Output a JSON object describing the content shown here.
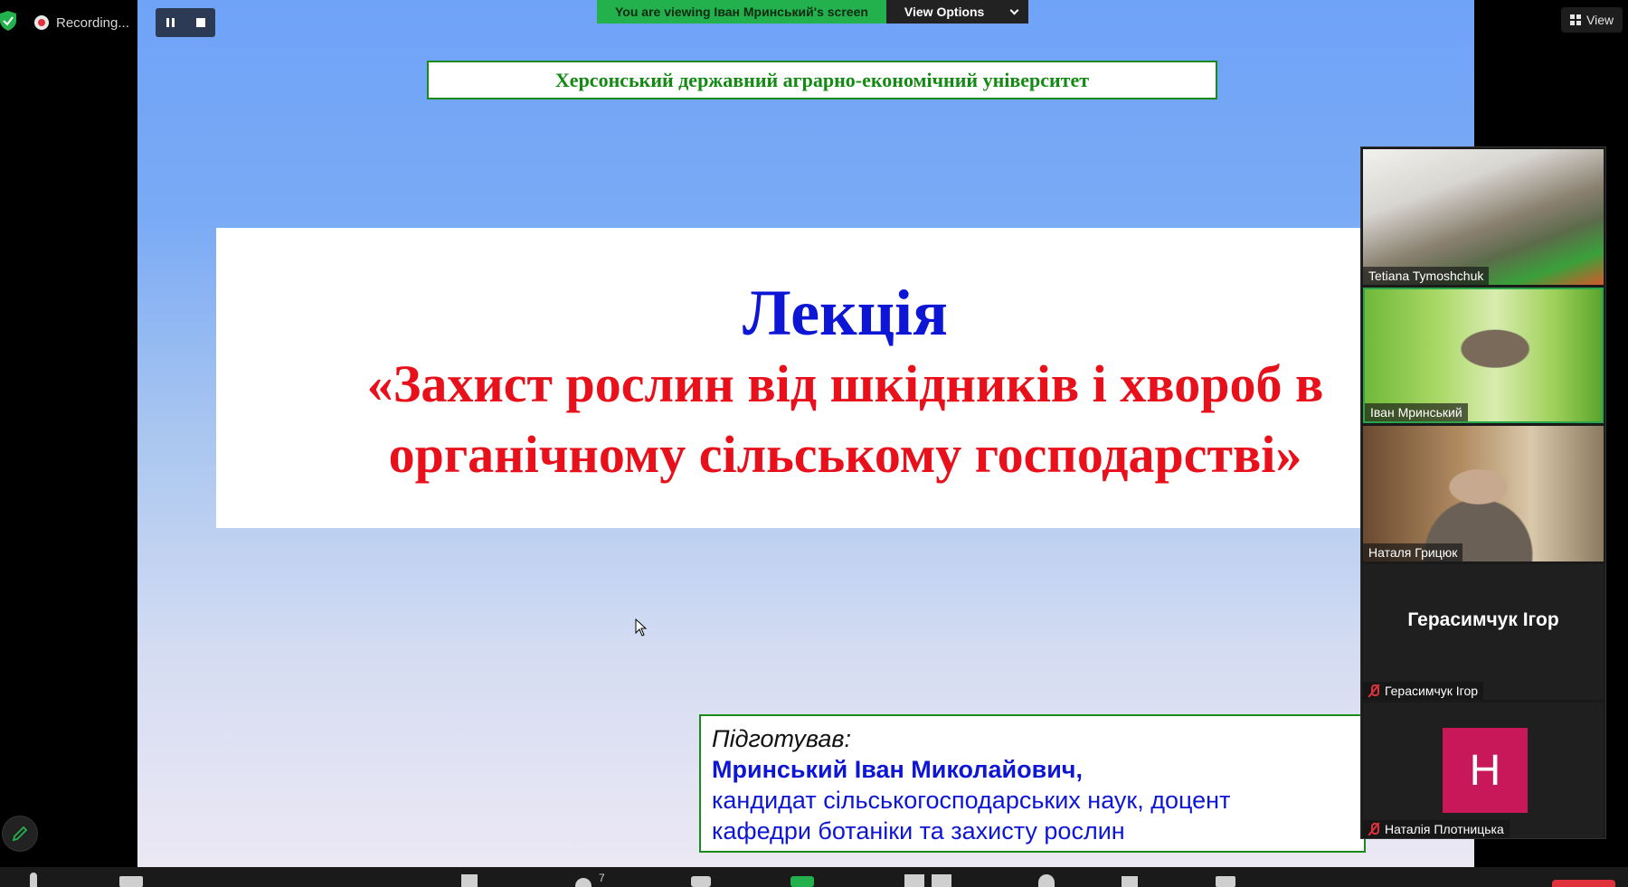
{
  "recording": {
    "label": "Recording...",
    "pause_label": "Pause recording",
    "stop_label": "Stop recording"
  },
  "banner": {
    "viewing_text": "You are viewing Іван Мринський's screen",
    "view_options_label": "View Options"
  },
  "view_button": {
    "label": "View"
  },
  "slide": {
    "university": "Херсонський державний аграрно-економічний університет",
    "title": "Лекція",
    "subtitle": "«Захист рослин від шкідників і хвороб в органічному сільському господарстві»",
    "prepared_label": "Підготував:",
    "author_name": "Мринський Іван Миколайович,",
    "author_position_line1": "кандидат сільськогосподарських наук, доцент",
    "author_position_line2": "кафедри ботаніки та захисту рослин"
  },
  "participants": [
    {
      "name": "Tetiana Tymoshchuk",
      "muted": false,
      "video": true
    },
    {
      "name": "Іван Мринський",
      "muted": false,
      "video": true,
      "active_speaker": true
    },
    {
      "name": "Наталя Грицюк",
      "muted": false,
      "video": true
    },
    {
      "name": "Герасимчук Ігор",
      "display_name": "Герасимчук Ігор",
      "muted": true,
      "video": false
    },
    {
      "name": "Наталія Плотницька",
      "avatar_letter": "H",
      "muted": true,
      "video": false
    }
  ],
  "toolbar": {
    "participants_count": "7"
  },
  "colors": {
    "accent_green": "#22b14c",
    "title_blue": "#0e16d6",
    "title_red": "#e8101b",
    "avatar_pink": "#c8185a",
    "mute_red": "#e0323b"
  },
  "icons": [
    "shield-check-icon",
    "record-icon",
    "pause-icon",
    "stop-icon",
    "chevron-down-icon",
    "grid-view-icon",
    "mic-muted-icon",
    "pencil-icon",
    "mouse-cursor-icon"
  ]
}
